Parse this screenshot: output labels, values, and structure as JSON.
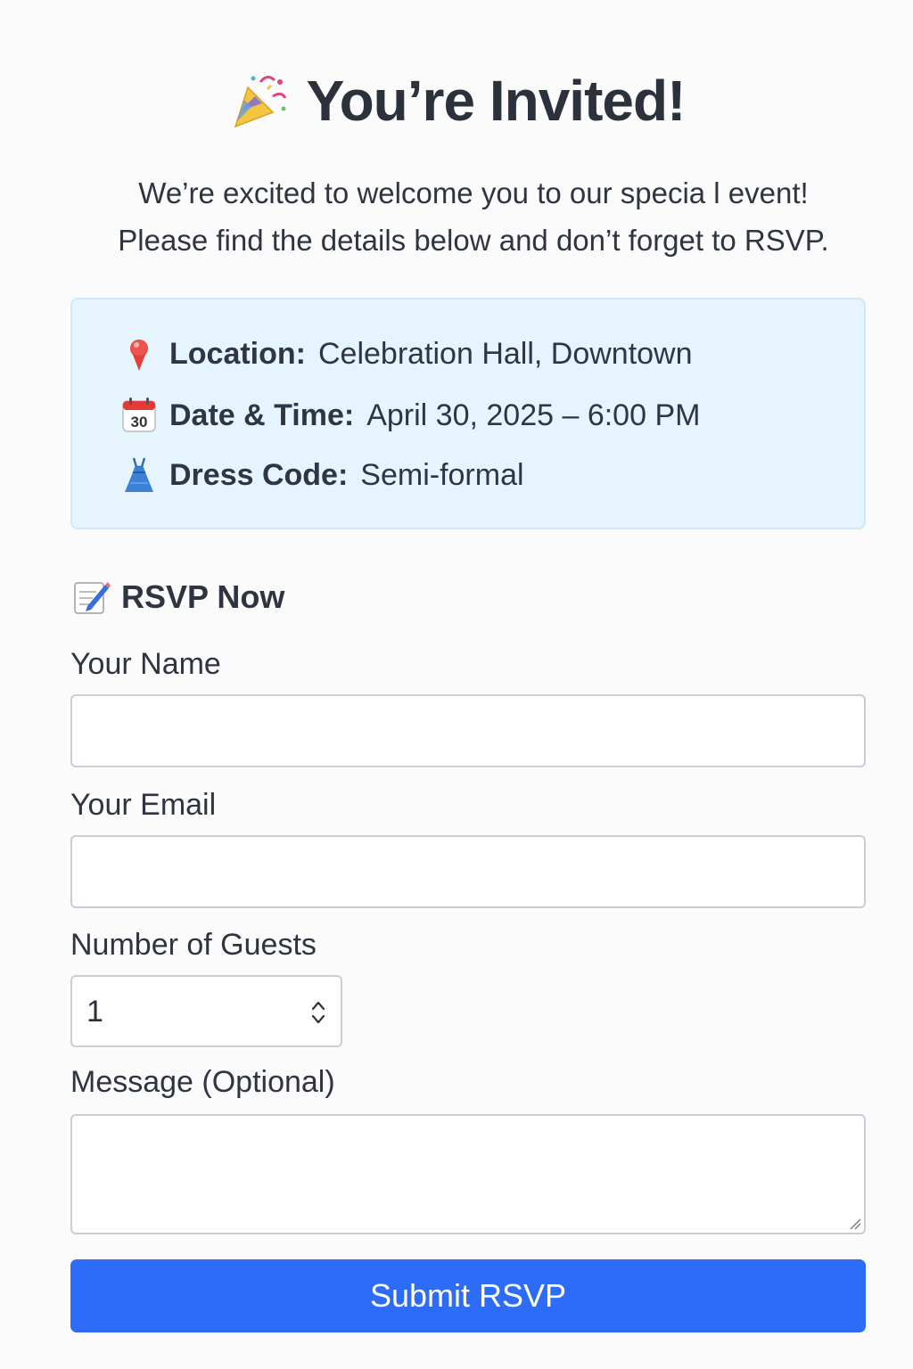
{
  "header": {
    "icon": "party-popper-icon",
    "title": "You’re Invited!"
  },
  "intro": {
    "line1": "We’re excited to welcome you to our specia l event!",
    "line2": "Please find the details below and don’t forget to RSVP."
  },
  "details": {
    "location": {
      "icon": "location-pin-icon",
      "label": "Location:",
      "value": "Celebration Hall, Downtown"
    },
    "datetime": {
      "icon": "calendar-icon",
      "calendar_day": "30",
      "label": "Date & Time:",
      "value": "April 30, 2025 – 6:00 PM"
    },
    "dress_code": {
      "icon": "dress-icon",
      "label": "Dress Code:",
      "value": "Semi-formal"
    },
    "background_color": "#e6f5fd"
  },
  "rsvp": {
    "icon": "memo-icon",
    "heading": "RSVP Now",
    "name_label": "Your Name",
    "name_value": "",
    "email_label": "Your Email",
    "email_value": "",
    "guests_label": "Number of Guests",
    "guests_value": "1",
    "message_label": "Message (Optional)",
    "message_value": "",
    "submit_label": "Submit RSVP",
    "accent_color": "#2c6cf6"
  }
}
